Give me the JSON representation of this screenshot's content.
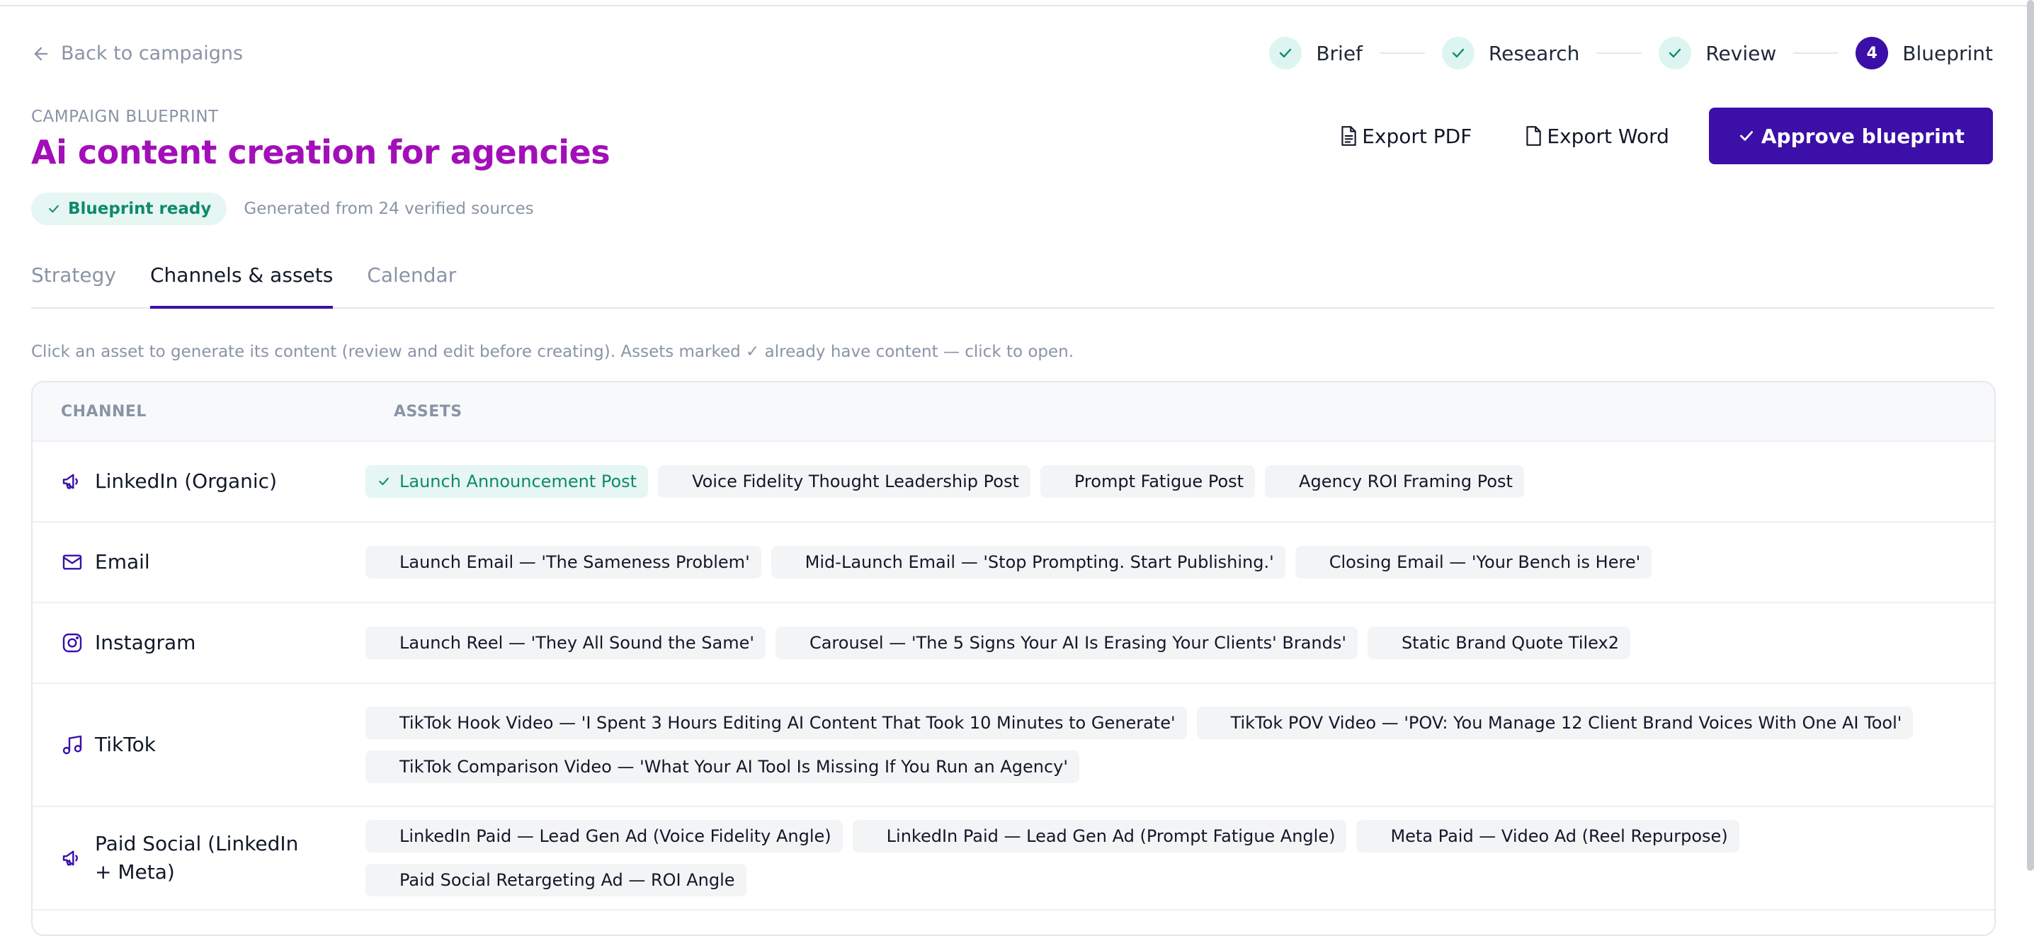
{
  "nav": {
    "back_label": "Back to campaigns"
  },
  "stepper": {
    "steps": [
      {
        "label": "Brief",
        "state": "done"
      },
      {
        "label": "Research",
        "state": "done"
      },
      {
        "label": "Review",
        "state": "done"
      },
      {
        "label": "Blueprint",
        "state": "active",
        "number": "4"
      }
    ]
  },
  "header": {
    "eyebrow": "CAMPAIGN BLUEPRINT",
    "title": "Ai content creation for agencies",
    "badge": "Blueprint ready",
    "sources": "Generated from 24 verified sources"
  },
  "actions": {
    "export_pdf": "Export PDF",
    "export_word": "Export Word",
    "approve": "Approve blueprint"
  },
  "tabs": [
    {
      "label": "Strategy",
      "active": false
    },
    {
      "label": "Channels & assets",
      "active": true
    },
    {
      "label": "Calendar",
      "active": false
    }
  ],
  "hint": "Click an asset to generate its content (review and edit before creating). Assets marked ✓ already have content — click to open.",
  "table": {
    "headers": {
      "channel": "CHANNEL",
      "assets": "ASSETS"
    },
    "rows": [
      {
        "channel": "LinkedIn (Organic)",
        "icon": "megaphone-icon",
        "assets": [
          {
            "label": "Launch Announcement Post",
            "done": true
          },
          {
            "label": "Voice Fidelity Thought Leadership Post",
            "done": false
          },
          {
            "label": "Prompt Fatigue Post",
            "done": false
          },
          {
            "label": "Agency ROI Framing Post",
            "done": false
          }
        ]
      },
      {
        "channel": "Email",
        "icon": "mail-icon",
        "assets": [
          {
            "label": "Launch Email — 'The Sameness Problem'",
            "done": false
          },
          {
            "label": "Mid-Launch Email — 'Stop Prompting. Start Publishing.'",
            "done": false
          },
          {
            "label": "Closing Email — 'Your Bench is Here'",
            "done": false
          }
        ]
      },
      {
        "channel": "Instagram",
        "icon": "instagram-icon",
        "assets": [
          {
            "label": "Launch Reel — 'They All Sound the Same'",
            "done": false
          },
          {
            "label": "Carousel — 'The 5 Signs Your AI Is Erasing Your Clients' Brands'",
            "done": false
          },
          {
            "label": "Static Brand Quote Tilex2",
            "done": false
          }
        ]
      },
      {
        "channel": "TikTok",
        "icon": "music-note-icon",
        "assets": [
          {
            "label": "TikTok Hook Video — 'I Spent 3 Hours Editing AI Content That Took 10 Minutes to Generate'",
            "done": false
          },
          {
            "label": "TikTok POV Video — 'POV: You Manage 12 Client Brand Voices With One AI Tool'",
            "done": false
          },
          {
            "label": "TikTok Comparison Video — 'What Your AI Tool Is Missing If You Run an Agency'",
            "done": false
          }
        ]
      },
      {
        "channel": "Paid Social (LinkedIn + Meta)",
        "icon": "megaphone-icon",
        "assets": [
          {
            "label": "LinkedIn Paid — Lead Gen Ad (Voice Fidelity Angle)",
            "done": false
          },
          {
            "label": "LinkedIn Paid — Lead Gen Ad (Prompt Fatigue Angle)",
            "done": false
          },
          {
            "label": "Meta Paid — Video Ad (Reel Repurpose)",
            "done": false
          },
          {
            "label": "Paid Social Retargeting Ad — ROI Angle",
            "done": false
          }
        ]
      }
    ]
  },
  "colors": {
    "accent": "#3b0fa8",
    "title": "#a20fb8",
    "success": "#0f8a6b",
    "success_bg": "#e6f6f2"
  }
}
